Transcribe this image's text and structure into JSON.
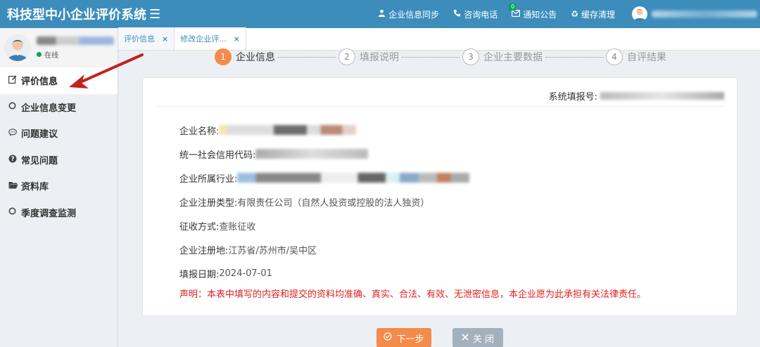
{
  "header": {
    "title": "科技型中小企业评价系统",
    "menu_icon": "bars-icon",
    "nav": [
      {
        "label": "企业信息同步",
        "icon": "user-icon"
      },
      {
        "label": "咨询电话",
        "icon": "phone-icon"
      },
      {
        "label": "通知公告",
        "icon": "envelope-icon",
        "badge": "0"
      },
      {
        "label": "缓存清理",
        "icon": "recycle-icon"
      }
    ]
  },
  "sidebar": {
    "status": "在线",
    "items": [
      {
        "label": "评价信息",
        "icon": "edit-icon",
        "active": true
      },
      {
        "label": "企业信息变更",
        "icon": "circle-icon"
      },
      {
        "label": "问题建议",
        "icon": "comment-icon"
      },
      {
        "label": "常见问题",
        "icon": "question-icon"
      },
      {
        "label": "资料库",
        "icon": "folder-icon"
      },
      {
        "label": "季度调查监测",
        "icon": "circle-icon"
      }
    ]
  },
  "tabs": [
    {
      "label": "评价信息",
      "close": "×"
    },
    {
      "label": "修改企业评...",
      "close": "×"
    }
  ],
  "steps": [
    {
      "num": "1",
      "label": "企业信息",
      "active": true
    },
    {
      "num": "2",
      "label": "填报说明"
    },
    {
      "num": "3",
      "label": "企业主要数据"
    },
    {
      "num": "4",
      "label": "自评结果"
    }
  ],
  "form": {
    "report_no_label": "系统填报号:",
    "fields": [
      {
        "label": "企业名称:",
        "value": ""
      },
      {
        "label": "统一社会信用代码:",
        "value": ""
      },
      {
        "label": "企业所属行业:",
        "value": ""
      },
      {
        "label": "企业注册类型:",
        "value": "有限责任公司（自然人投资或控股的法人独资）"
      },
      {
        "label": "征收方式:",
        "value": "查账征收"
      },
      {
        "label": "企业注册地:",
        "value": "江苏省/苏州市/吴中区"
      },
      {
        "label": "填报日期:",
        "value": "2024-07-01"
      }
    ],
    "declaration": "声明：本表中填写的内容和提交的资料均准确、真实、合法、有效、无泄密信息，本企业愿为此承担有关法律责任。"
  },
  "buttons": {
    "next": "下一步",
    "close": "关 闭"
  },
  "colors": {
    "header_bg": "#3c8dbc",
    "accent_orange": "#f38b4a",
    "declaration_red": "#e02020",
    "online_green": "#00a65a",
    "annotation_red": "#c0231a"
  }
}
